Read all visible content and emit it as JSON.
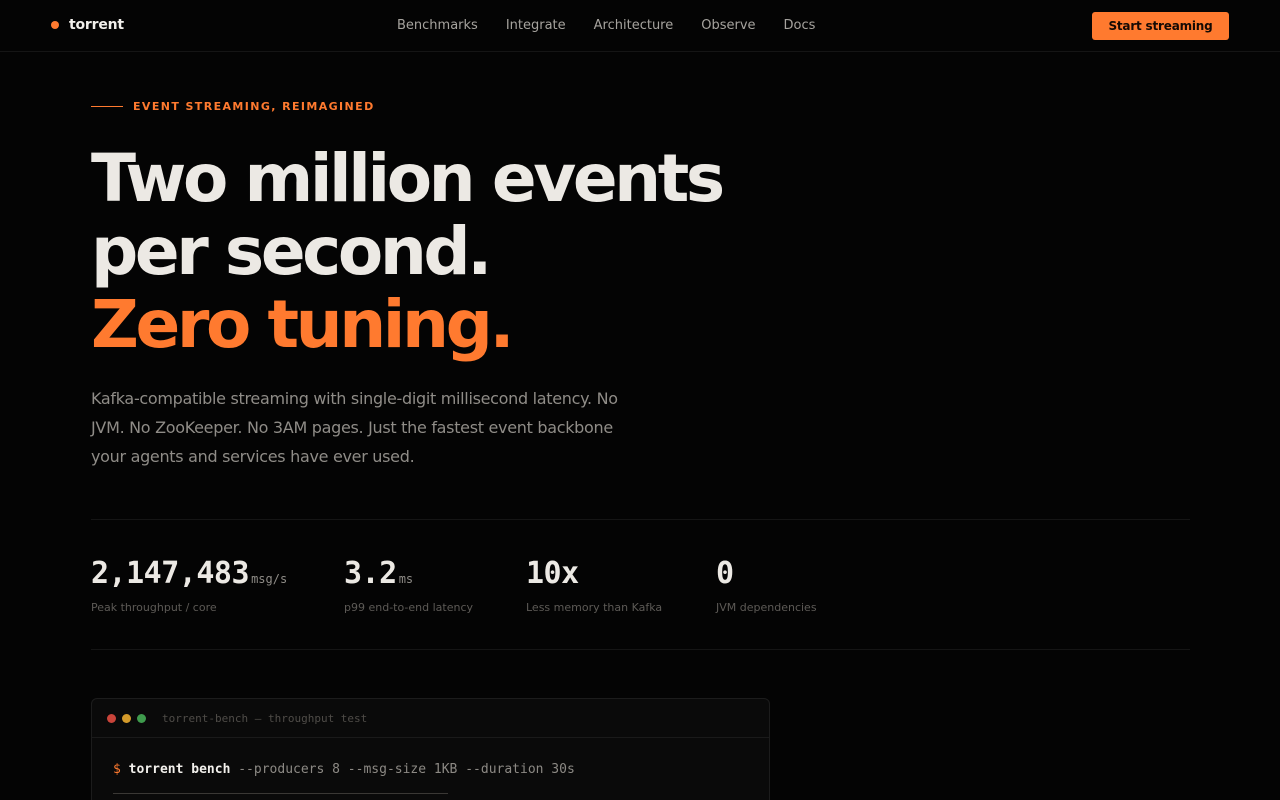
{
  "nav": {
    "brand": "torrent",
    "links": [
      "Benchmarks",
      "Integrate",
      "Architecture",
      "Observe",
      "Docs"
    ],
    "cta": "Start streaming"
  },
  "hero": {
    "eyebrow": "EVENT STREAMING, REIMAGINED",
    "line1": "Two million events",
    "line2": "per second.",
    "line3": "Zero tuning.",
    "lead": "Kafka-compatible streaming with single-digit millisecond latency. No JVM. No ZooKeeper. No 3AM pages. Just the fastest event backbone your agents and services have ever used."
  },
  "stats": [
    {
      "value": "2,147,483",
      "unit": "msg/s",
      "label": "Peak throughput / core"
    },
    {
      "value": "3.2",
      "unit": "ms",
      "label": "p99 end-to-end latency"
    },
    {
      "value": "10x",
      "unit": "",
      "label": "Less memory than Kafka"
    },
    {
      "value": "0",
      "unit": "",
      "label": "JVM dependencies"
    }
  ],
  "terminal": {
    "title": "torrent-bench — throughput test",
    "prompt": "$",
    "command": "torrent bench",
    "args": "--producers 8 --msg-size 1KB --duration 30s"
  },
  "colors": {
    "accent": "#ff7a2f",
    "light_red": "#c9443a",
    "light_yellow": "#d39a2a",
    "light_green": "#3f9b4d"
  }
}
